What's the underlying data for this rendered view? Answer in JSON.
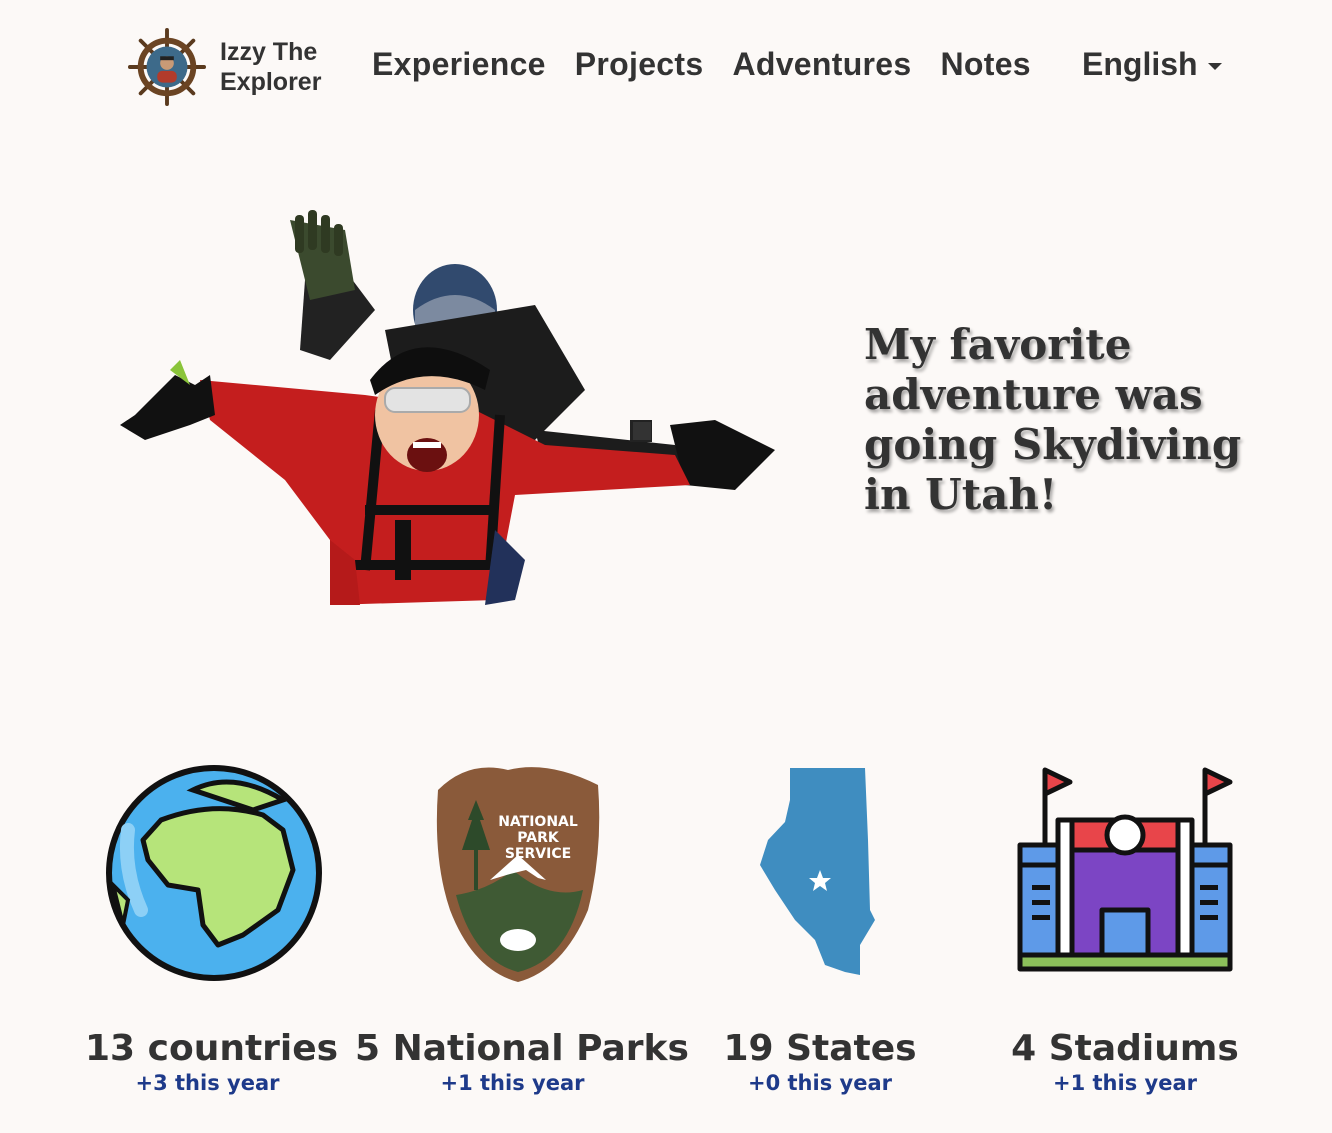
{
  "nav": {
    "brand_line1": "Izzy The",
    "brand_line2": "Explorer",
    "links": [
      "Experience",
      "Projects",
      "Adventures",
      "Notes"
    ],
    "language": "English"
  },
  "hero": {
    "line1": "My favorite",
    "line2": "adventure was",
    "line3": "going Skydiving",
    "line4": "in Utah!"
  },
  "stats": [
    {
      "icon": "globe-icon",
      "label": "13 countries",
      "sub": "+3 this year"
    },
    {
      "icon": "national-park-service-icon",
      "label": "5 National Parks",
      "sub": "+1 this year",
      "badge_line1": "NATIONAL",
      "badge_line2": "PARK",
      "badge_line3": "SERVICE"
    },
    {
      "icon": "illinois-state-icon",
      "label": "19 States",
      "sub": "+0 this year"
    },
    {
      "icon": "stadium-icon",
      "label": "4 Stadiums",
      "sub": "+1 this year"
    }
  ],
  "colors": {
    "background": "#fcf9f7",
    "text": "#333333",
    "accent_blue": "#1e3a8a"
  }
}
